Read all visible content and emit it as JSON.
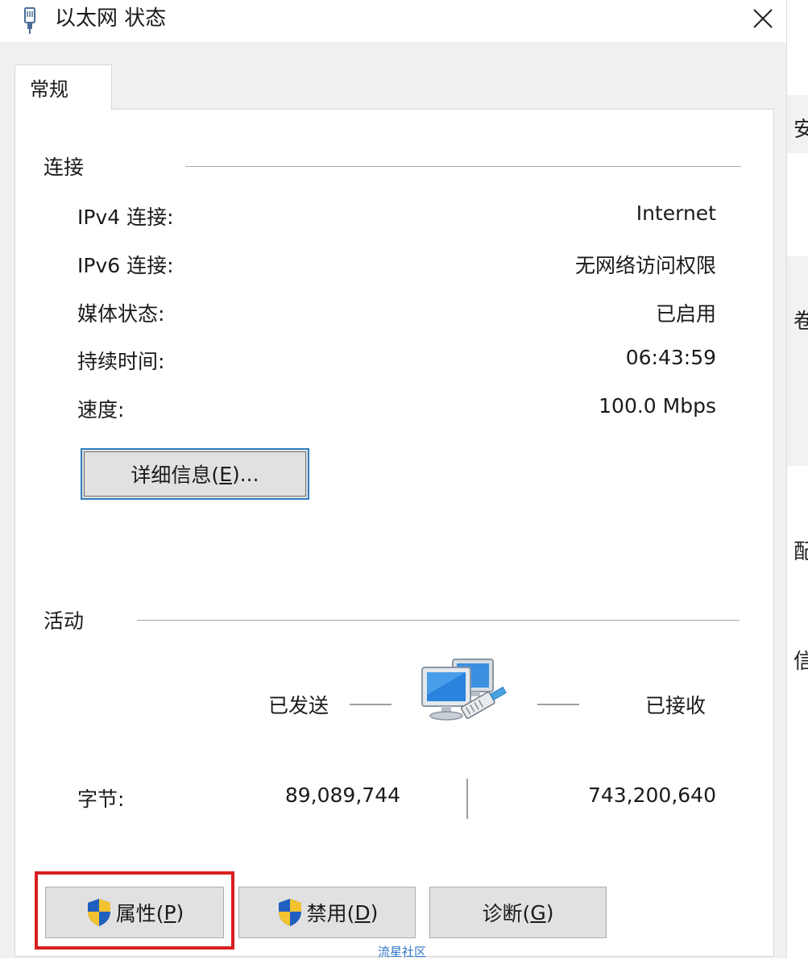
{
  "window": {
    "title": "以太网 状态",
    "close_glyph": "✕"
  },
  "tabs": [
    {
      "label": "常规"
    }
  ],
  "connection": {
    "label": "连接",
    "rows": [
      {
        "label": "IPv4 连接:",
        "value": "Internet"
      },
      {
        "label": "IPv6 连接:",
        "value": "无网络访问权限"
      },
      {
        "label": "媒体状态:",
        "value": "已启用"
      },
      {
        "label": "持续时间:",
        "value": "06:43:59"
      },
      {
        "label": "速度:",
        "value": "100.0 Mbps"
      }
    ],
    "details_button": {
      "text": "详细信息(",
      "mnemonic": "E",
      "suffix": ")..."
    }
  },
  "activity": {
    "label": "活动",
    "sent_label": "已发送",
    "received_label": "已接收",
    "bytes_label": "字节:",
    "bytes_sent": "89,089,744",
    "bytes_received": "743,200,640"
  },
  "buttons": {
    "properties": {
      "text": "属性(",
      "mnemonic": "P",
      "suffix": ")"
    },
    "disable": {
      "text": "禁用(",
      "mnemonic": "D",
      "suffix": ")"
    },
    "diagnose": {
      "text": "诊断(",
      "mnemonic": "G",
      "suffix": ")"
    }
  },
  "background_strip": {
    "chars": [
      "安",
      "卷",
      "配",
      "信"
    ]
  },
  "watermark": "流星社区",
  "colors": {
    "highlight": "#d91f1f",
    "focus": "#2f7ec1",
    "shield_blue": "#1f5fbf",
    "shield_yellow": "#f2c230"
  },
  "icons": [
    "network-adapter-icon",
    "close-icon",
    "network-computers-icon",
    "uac-shield-icon"
  ]
}
